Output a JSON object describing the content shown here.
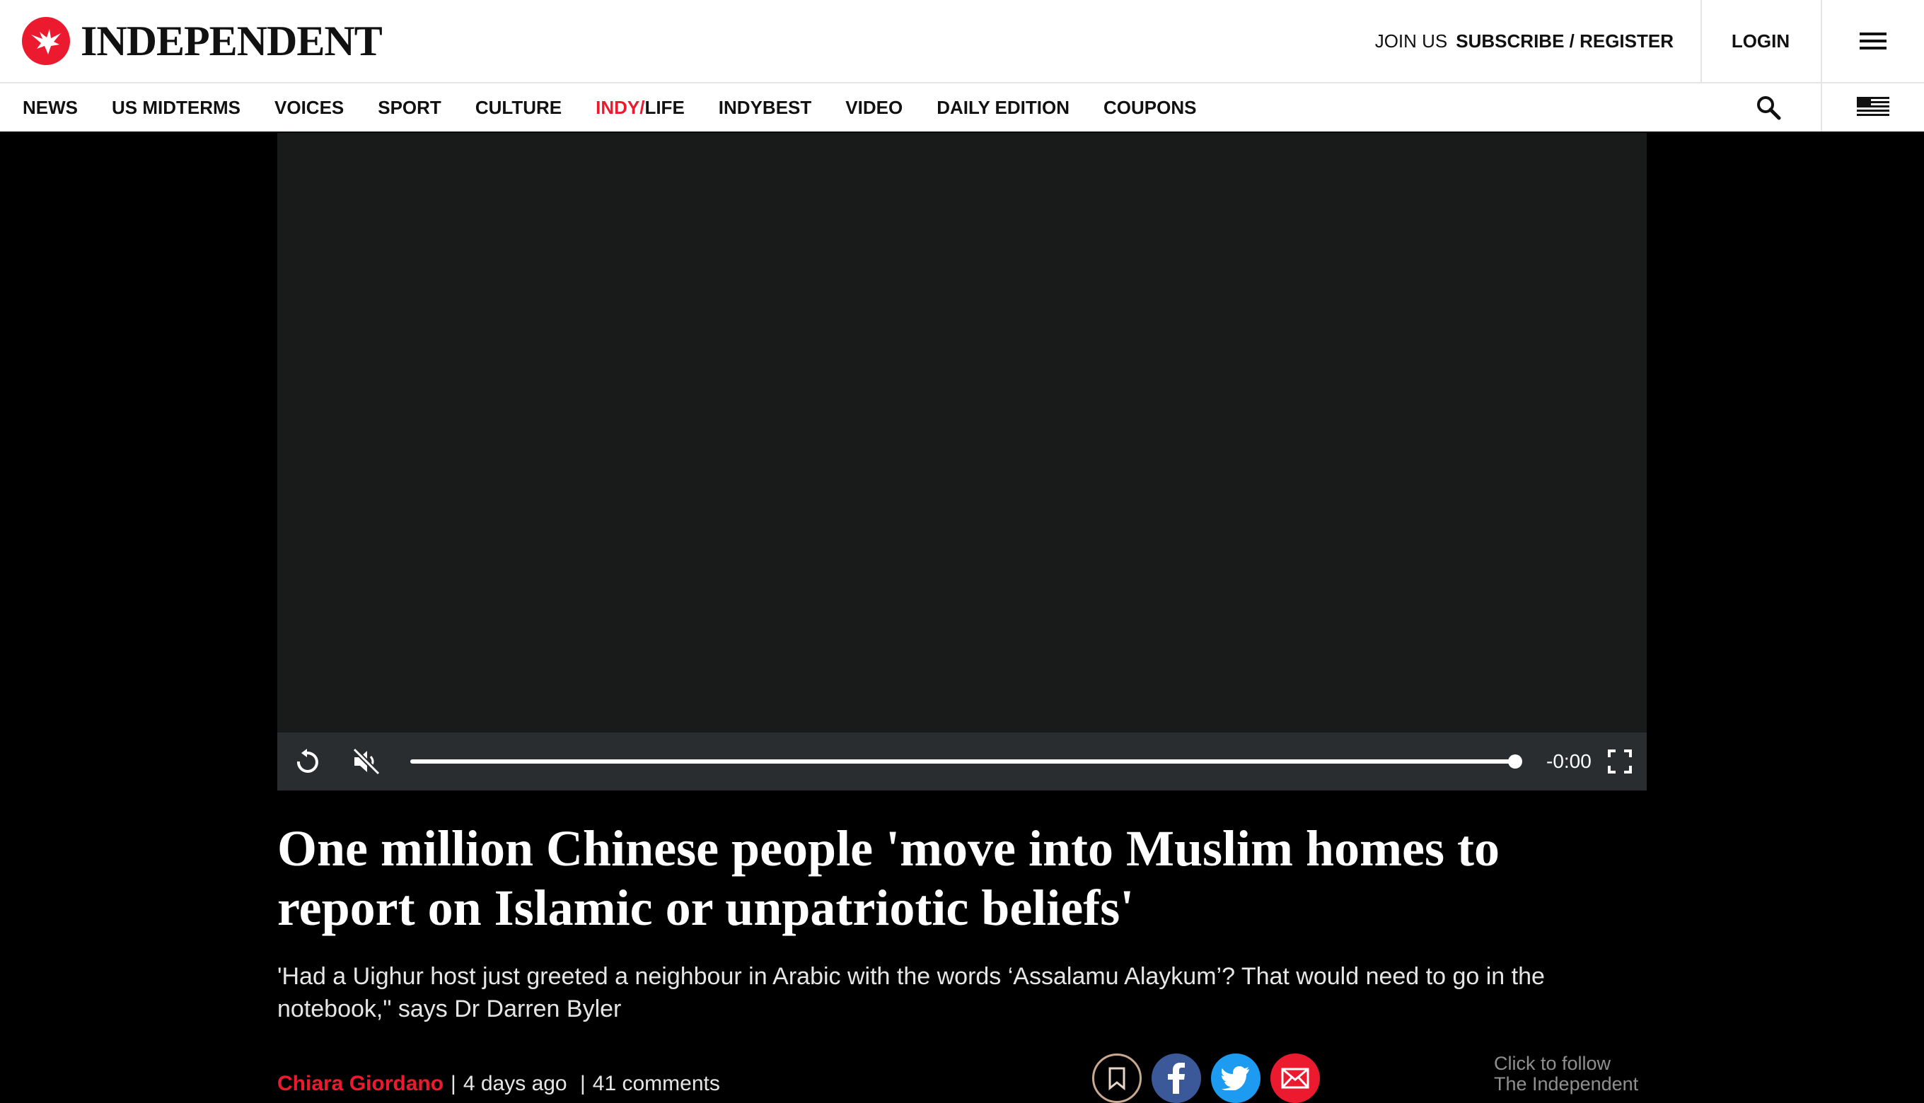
{
  "header": {
    "logo_text": "INDEPENDENT",
    "join_label": "JOIN US",
    "subscribe_label": "SUBSCRIBE / REGISTER",
    "login_label": "LOGIN",
    "menu_icon": "hamburger-icon"
  },
  "nav": {
    "items": [
      {
        "label": "NEWS"
      },
      {
        "label": "US MIDTERMS"
      },
      {
        "label": "VOICES"
      },
      {
        "label": "SPORT"
      },
      {
        "label": "CULTURE"
      },
      {
        "label_red": "INDY/",
        "label_rest": "LIFE"
      },
      {
        "label": "INDYBEST"
      },
      {
        "label": "VIDEO"
      },
      {
        "label": "DAILY EDITION"
      },
      {
        "label": "COUPONS"
      }
    ],
    "search_icon": "search-icon",
    "edition_icon": "us-flag-icon"
  },
  "video": {
    "time_remaining": "-0:00",
    "progress": 1.0,
    "muted": true,
    "replay_icon": "replay-icon",
    "mute_icon": "muted-speaker-icon",
    "fullscreen_icon": "fullscreen-icon"
  },
  "article": {
    "headline": "One million Chinese people 'move into Muslim homes to report on Islamic or unpatriotic beliefs'",
    "standfirst": "'Had a Uighur host just greeted a neighbour in Arabic with the words ‘Assalamu Alaykum’? That would need to go in the notebook,\" says Dr Darren Byler",
    "author": "Chiara Giordano",
    "time_ago": "4 days ago",
    "comments": "41 comments",
    "follow_line1": "Click to follow",
    "follow_line2": "The Independent"
  },
  "colors": {
    "brand_red": "#ec1a2e",
    "facebook": "#3b5998",
    "twitter": "#1d9bf0"
  }
}
